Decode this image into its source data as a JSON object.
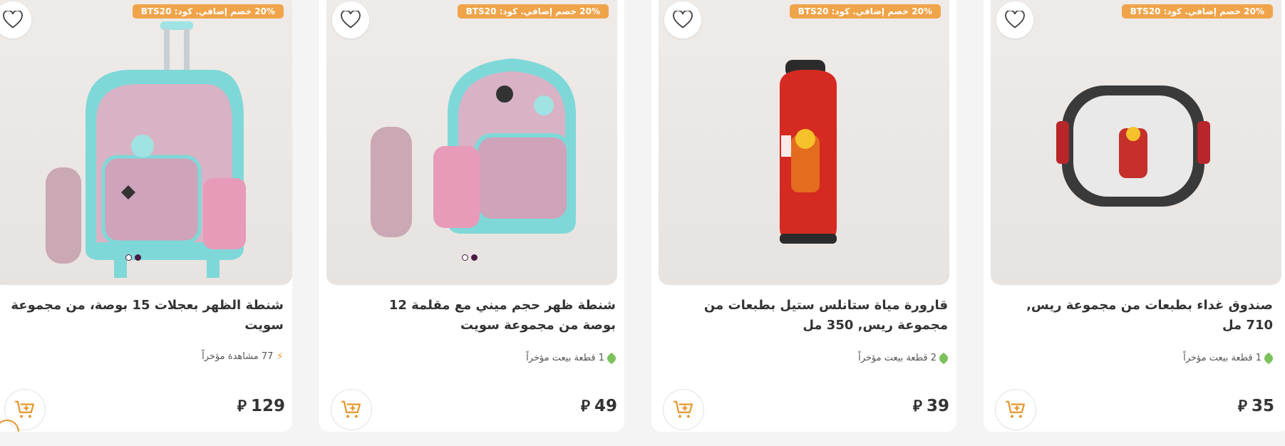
{
  "colors": {
    "accent": "#f0a44a",
    "promo_bg": "#f0a44a",
    "tag_green": "#7cc15a",
    "dot_active": "#4a1842"
  },
  "products": [
    {
      "promo": "20% خصم إضافي. كود: BTS20",
      "title": "شنطة الظهر بعجلات 15 بوصة، من مجموعة سويت",
      "meta_text": "77 مشاهدة مؤخراً",
      "meta_icon": "lightning-icon",
      "price": "129",
      "currency": "⃁",
      "image": "trolley-backpack-with-pencil-case",
      "dots": 2
    },
    {
      "promo": "20% خصم إضافي. كود: BTS20",
      "title": "شنطة ظهر حجم ميني مع مقلمة 12 بوصة من مجموعة سويت",
      "meta_text": "1 قطعة بيعت مؤخراً",
      "meta_icon": "tag-icon",
      "price": "49",
      "currency": "⃁",
      "image": "mini-backpack-with-pencil-case",
      "dots": 2
    },
    {
      "promo": "20% خصم إضافي. كود: BTS20",
      "title": "قارورة مياة ستانلس ستيل بطبعات من مجموعة ريس, 350 مل",
      "meta_text": "2 قطعة بيعت مؤخراً",
      "meta_icon": "tag-icon",
      "price": "39",
      "currency": "⃁",
      "image": "red-water-bottle"
    },
    {
      "promo": "20% خصم إضافي. كود: BTS20",
      "title": "صندوق غداء بطبعات من مجموعة ريس, 710 مل",
      "meta_text": "1 قطعة بيعت مؤخراً",
      "meta_icon": "tag-icon",
      "price": "35",
      "currency": "⃁",
      "image": "race-lunch-box"
    }
  ]
}
